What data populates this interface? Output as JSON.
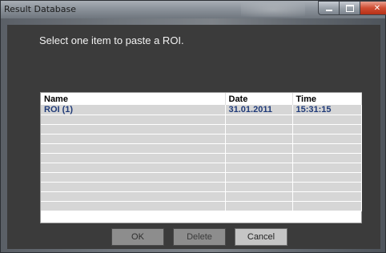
{
  "window": {
    "title": "Result Database"
  },
  "dialog": {
    "prompt": "Select one item to paste a ROI."
  },
  "table": {
    "columns": [
      "Name",
      "Date",
      "Time"
    ],
    "rows": [
      [
        "ROI (1)",
        "31.01.2011",
        "15:31:15"
      ],
      [
        "",
        "",
        ""
      ],
      [
        "",
        "",
        ""
      ],
      [
        "",
        "",
        ""
      ],
      [
        "",
        "",
        ""
      ],
      [
        "",
        "",
        ""
      ],
      [
        "",
        "",
        ""
      ],
      [
        "",
        "",
        ""
      ],
      [
        "",
        "",
        ""
      ],
      [
        "",
        "",
        ""
      ],
      [
        "",
        "",
        ""
      ]
    ]
  },
  "buttons": {
    "ok": "OK",
    "delete": "Delete",
    "cancel": "Cancel"
  },
  "icons": {
    "minimize": "minimize-icon",
    "maximize": "maximize-icon",
    "close": "close-icon"
  },
  "colors": {
    "dialog_bg": "#3b3b3b",
    "grid_cell": "#d6d6d6",
    "row_text": "#1f3a78",
    "close": "#cf4d32"
  }
}
